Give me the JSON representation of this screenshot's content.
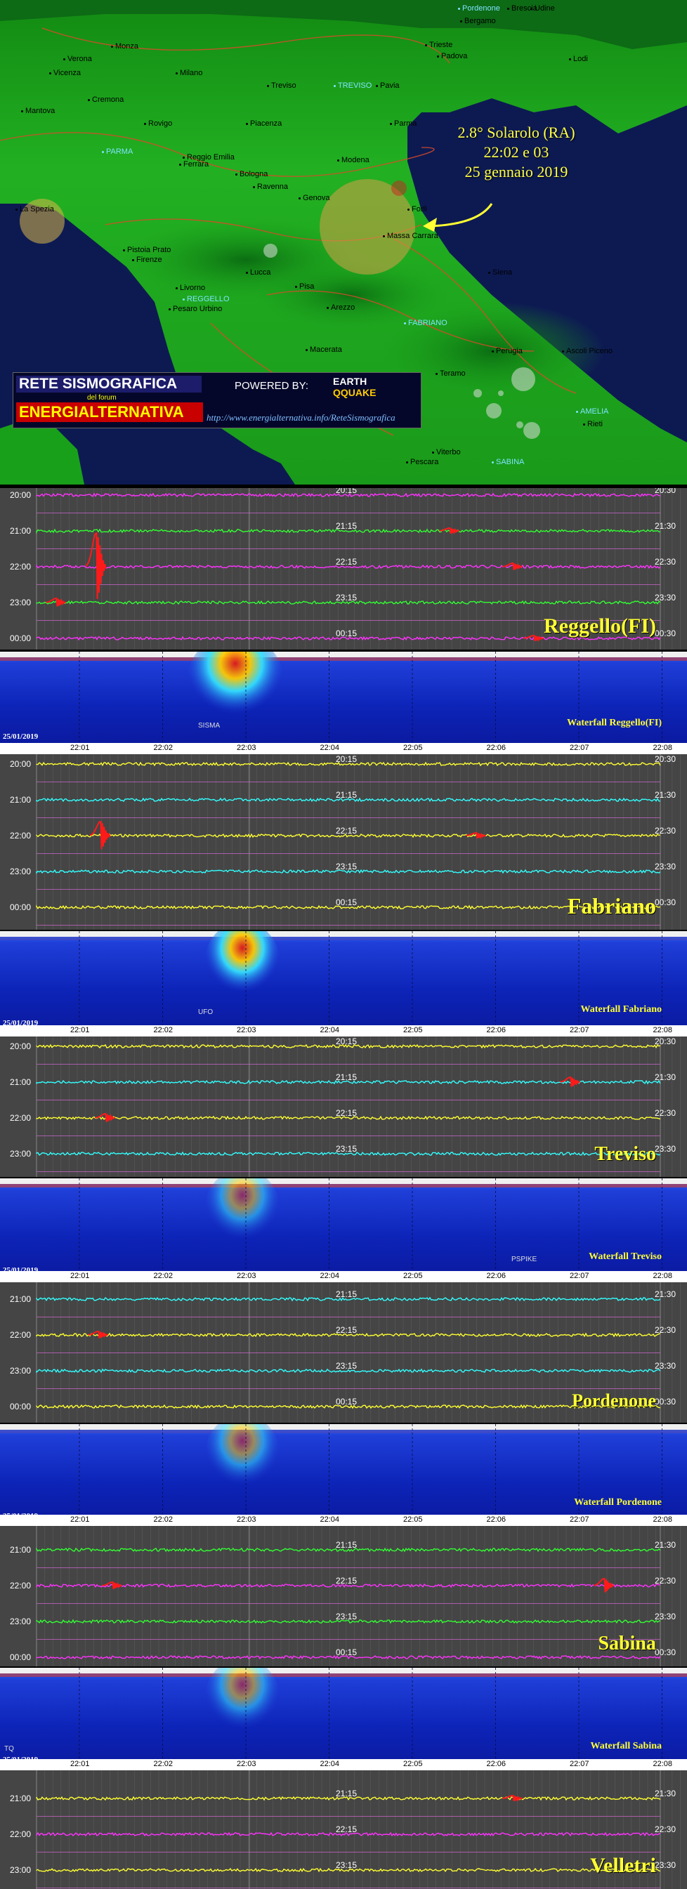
{
  "map": {
    "cities": [
      {
        "name": "Pordenone",
        "kind": "station"
      },
      {
        "name": "Udine",
        "kind": "city"
      },
      {
        "name": "Bergamo",
        "kind": "city"
      },
      {
        "name": "Brescia",
        "kind": "city"
      },
      {
        "name": "Monza",
        "kind": "city"
      },
      {
        "name": "Milano",
        "kind": "city"
      },
      {
        "name": "Verona",
        "kind": "city"
      },
      {
        "name": "Vicenza",
        "kind": "city"
      },
      {
        "name": "Treviso",
        "kind": "city"
      },
      {
        "name": "TREVISO",
        "kind": "station"
      },
      {
        "name": "Trieste",
        "kind": "city"
      },
      {
        "name": "Padova",
        "kind": "city"
      },
      {
        "name": "Lodi",
        "kind": "city"
      },
      {
        "name": "Pavia",
        "kind": "city"
      },
      {
        "name": "Cremona",
        "kind": "city"
      },
      {
        "name": "Mantova",
        "kind": "city"
      },
      {
        "name": "Rovigo",
        "kind": "city"
      },
      {
        "name": "Piacenza",
        "kind": "city"
      },
      {
        "name": "Parma",
        "kind": "city"
      },
      {
        "name": "PARMA",
        "kind": "station"
      },
      {
        "name": "Ferrara",
        "kind": "city"
      },
      {
        "name": "Reggio Emilia",
        "kind": "city"
      },
      {
        "name": "Modena",
        "kind": "city"
      },
      {
        "name": "Bologna",
        "kind": "city"
      },
      {
        "name": "Ravenna",
        "kind": "city"
      },
      {
        "name": "Genova",
        "kind": "city"
      },
      {
        "name": "Forlì",
        "kind": "city"
      },
      {
        "name": "La Spezia",
        "kind": "city"
      },
      {
        "name": "Massa Carrara",
        "kind": "city"
      },
      {
        "name": "Pistoia Prato",
        "kind": "city"
      },
      {
        "name": "Firenze",
        "kind": "city"
      },
      {
        "name": "Lucca",
        "kind": "city"
      },
      {
        "name": "Pisa",
        "kind": "city"
      },
      {
        "name": "Livorno",
        "kind": "city"
      },
      {
        "name": "REGGELLO",
        "kind": "station"
      },
      {
        "name": "Pesaro Urbino",
        "kind": "city"
      },
      {
        "name": "Arezzo",
        "kind": "city"
      },
      {
        "name": "Siena",
        "kind": "city"
      },
      {
        "name": "FABRIANO",
        "kind": "station"
      },
      {
        "name": "Macerata",
        "kind": "city"
      },
      {
        "name": "Perugia",
        "kind": "city"
      },
      {
        "name": "Ascoli Piceno",
        "kind": "city"
      },
      {
        "name": "Teramo",
        "kind": "city"
      },
      {
        "name": "AMELIA",
        "kind": "station"
      },
      {
        "name": "Rieti",
        "kind": "city"
      },
      {
        "name": "Viterbo",
        "kind": "city"
      },
      {
        "name": "SABINA",
        "kind": "station"
      },
      {
        "name": "Pescara",
        "kind": "city"
      }
    ],
    "annotation": {
      "line1": "2.8° Solarolo (RA)",
      "line2": "22:02 e 03",
      "line3": "25 gennaio 2019"
    }
  },
  "logo": {
    "title": "RETE SISMOGRAFICA",
    "subtitle": "del forum",
    "brand": "ENERGIALTERNATIVA",
    "powered": "POWERED BY:",
    "partner_line1": "EARTH",
    "partner_line2": "QQUAKE",
    "url": "http://www.energialternativa.info/ReteSismografica"
  },
  "colors": {
    "trace_magenta": "#ff33ff",
    "trace_green": "#33ff33",
    "trace_yellow": "#ffff33",
    "trace_cyan": "#33ffff",
    "event_red": "#ff1a1a",
    "panel_bg": "#454545",
    "title_yellow": "#ffff33"
  },
  "date": "25/01/2019",
  "time_axis": [
    "22:01",
    "22:02",
    "22:03",
    "22:04",
    "22:05",
    "22:06",
    "22:07",
    "22:08"
  ],
  "stations": [
    {
      "id": "reggello",
      "title": "Reggello(FI)",
      "waterfall_title": "Waterfall Reggello(FI)",
      "waterfall_note": "SISMA",
      "rows": [
        {
          "left": "20:00",
          "mid": "20:15",
          "right": "20:30",
          "color": "magenta"
        },
        {
          "left": "21:00",
          "mid": "21:15",
          "right": "21:30",
          "color": "green"
        },
        {
          "left": "22:00",
          "mid": "22:15",
          "right": "22:30",
          "color": "magenta"
        },
        {
          "left": "23:00",
          "mid": "23:15",
          "right": "23:30",
          "color": "green"
        },
        {
          "left": "00:00",
          "mid": "00:15",
          "right": "00:30",
          "color": "magenta"
        }
      ]
    },
    {
      "id": "fabriano",
      "title": "Fabriano",
      "waterfall_title": "Waterfall Fabriano",
      "waterfall_note": "UFO",
      "rows": [
        {
          "left": "20:00",
          "mid": "20:15",
          "right": "20:30",
          "color": "yellow"
        },
        {
          "left": "21:00",
          "mid": "21:15",
          "right": "21:30",
          "color": "cyan"
        },
        {
          "left": "22:00",
          "mid": "22:15",
          "right": "22:30",
          "color": "yellow"
        },
        {
          "left": "23:00",
          "mid": "23:15",
          "right": "23:30",
          "color": "cyan"
        },
        {
          "left": "00:00",
          "mid": "00:15",
          "right": "00:30",
          "color": "yellow"
        }
      ]
    },
    {
      "id": "treviso",
      "title": "Treviso",
      "waterfall_title": "Waterfall Treviso",
      "waterfall_note": "PSPIKE",
      "rows": [
        {
          "left": "20:00",
          "mid": "20:15",
          "right": "20:30",
          "color": "yellow"
        },
        {
          "left": "21:00",
          "mid": "21:15",
          "right": "21:30",
          "color": "cyan"
        },
        {
          "left": "22:00",
          "mid": "22:15",
          "right": "22:30",
          "color": "yellow"
        },
        {
          "left": "23:00",
          "mid": "23:15",
          "right": "23:30",
          "color": "cyan"
        }
      ]
    },
    {
      "id": "pordenone",
      "title": "Pordenone",
      "waterfall_title": "Waterfall Pordenone",
      "waterfall_note": "",
      "rows": [
        {
          "left": "21:00",
          "mid": "21:15",
          "right": "21:30",
          "color": "cyan"
        },
        {
          "left": "22:00",
          "mid": "22:15",
          "right": "22:30",
          "color": "yellow"
        },
        {
          "left": "23:00",
          "mid": "23:15",
          "right": "23:30",
          "color": "cyan"
        },
        {
          "left": "00:00",
          "mid": "00:15",
          "right": "00:30",
          "color": "yellow"
        }
      ]
    },
    {
      "id": "sabina",
      "title": "Sabina",
      "waterfall_title": "Waterfall Sabina",
      "waterfall_note": "TQ",
      "rows": [
        {
          "left": "21:00",
          "mid": "21:15",
          "right": "21:30",
          "color": "green"
        },
        {
          "left": "22:00",
          "mid": "22:15",
          "right": "22:30",
          "color": "magenta"
        },
        {
          "left": "23:00",
          "mid": "23:15",
          "right": "23:30",
          "color": "green"
        },
        {
          "left": "00:00",
          "mid": "00:15",
          "right": "00:30",
          "color": "magenta"
        }
      ]
    },
    {
      "id": "velletri",
      "title": "Velletri",
      "waterfall_title": "",
      "waterfall_note": "",
      "rows": [
        {
          "left": "21:00",
          "mid": "21:15",
          "right": "21:30",
          "color": "yellow"
        },
        {
          "left": "22:00",
          "mid": "22:15",
          "right": "22:30",
          "color": "magenta"
        },
        {
          "left": "23:00",
          "mid": "23:15",
          "right": "23:30",
          "color": "yellow"
        }
      ]
    }
  ]
}
